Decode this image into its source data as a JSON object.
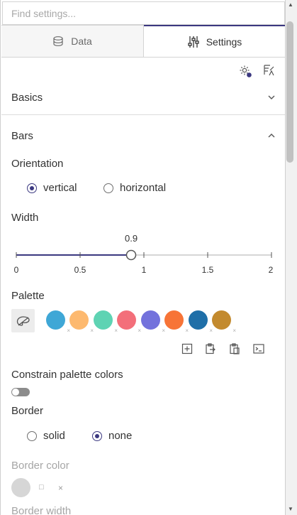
{
  "search": {
    "placeholder": "Find settings..."
  },
  "tabs": [
    {
      "label": "Data",
      "icon": "database-icon",
      "active": false
    },
    {
      "label": "Settings",
      "icon": "sliders-icon",
      "active": true
    }
  ],
  "toolbar": {
    "icons": [
      "gear-icon",
      "code-config-icon"
    ]
  },
  "sections": {
    "basics": {
      "title": "Basics",
      "expanded": false
    },
    "bars": {
      "title": "Bars",
      "expanded": true
    }
  },
  "orientation": {
    "label": "Orientation",
    "options": [
      "vertical",
      "horizontal"
    ],
    "selected": "vertical"
  },
  "width": {
    "label": "Width",
    "value": "0.9",
    "value_num": 0.9,
    "min": 0,
    "max": 2,
    "ticks": [
      "0",
      "0.5",
      "1",
      "1.5",
      "2"
    ]
  },
  "palette": {
    "label": "Palette",
    "colors": [
      "#3fa7d6",
      "#fdb96f",
      "#5ed3b3",
      "#f36f7a",
      "#7372dc",
      "#f77437",
      "#1f6fa8",
      "#c38a2e"
    ],
    "actions": [
      "add-icon",
      "copy-icon",
      "paste-icon",
      "terminal-icon"
    ]
  },
  "constrain": {
    "label": "Constrain palette colors",
    "enabled": false
  },
  "border": {
    "label": "Border",
    "options": [
      "solid",
      "none"
    ],
    "selected": "none"
  },
  "border_color": {
    "label": "Border color",
    "symbols": [
      "□",
      "×"
    ]
  },
  "border_width": {
    "label": "Border width"
  },
  "colors": {
    "accent": "#3b3880"
  }
}
